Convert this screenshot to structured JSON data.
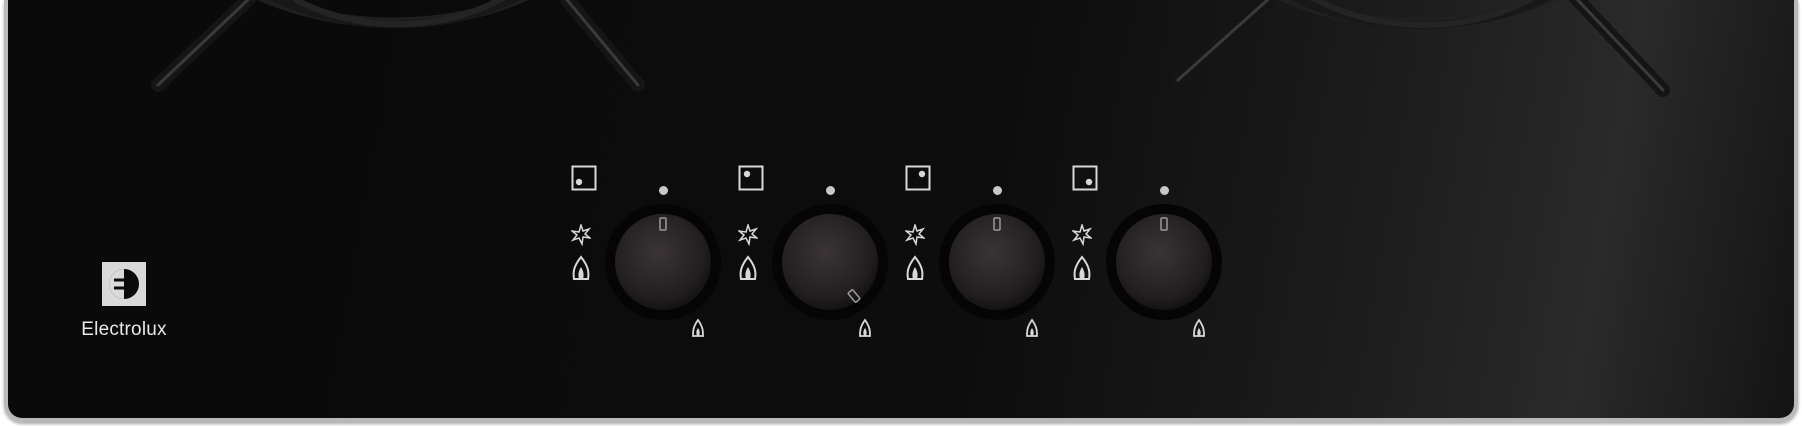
{
  "brand": {
    "name": "Electrolux",
    "logo_icon": "electrolux-logo-icon"
  },
  "colors": {
    "glass": "#0b0b0b",
    "frame": "#b9b9b9",
    "symbol": "#d8d8d8"
  },
  "controls": [
    {
      "id": "knob-1",
      "zone_icon": "burner-zone-icon",
      "state": "off"
    },
    {
      "id": "knob-2",
      "zone_icon": "burner-zone-icon",
      "state": "low"
    },
    {
      "id": "knob-3",
      "zone_icon": "burner-zone-icon",
      "state": "off"
    },
    {
      "id": "knob-4",
      "zone_icon": "burner-zone-icon",
      "state": "off"
    }
  ]
}
